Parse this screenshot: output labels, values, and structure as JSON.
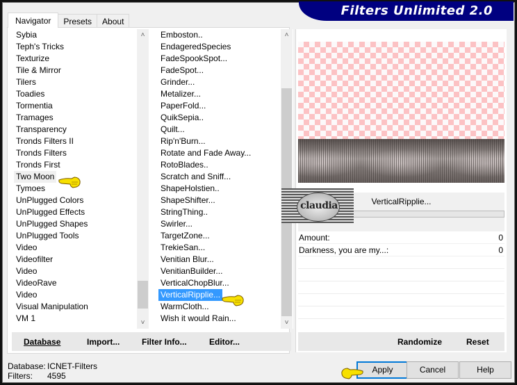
{
  "window": {
    "banner_title": "Filters Unlimited 2.0"
  },
  "tabs": [
    {
      "label": "Navigator",
      "active": true
    },
    {
      "label": "Presets",
      "active": false
    },
    {
      "label": "About",
      "active": false
    }
  ],
  "category_list": {
    "items": [
      "Sybia",
      "Teph's Tricks",
      "Texturize",
      "Tile & Mirror",
      "Tilers",
      "Toadies",
      "Tormentia",
      "Tramages",
      "Transparency",
      "Tronds Filters II",
      "Tronds Filters",
      "Tronds First",
      "Two Moon",
      "Tymoes",
      "UnPlugged Colors",
      "UnPlugged Effects",
      "UnPlugged Shapes",
      "UnPlugged Tools",
      "Video",
      "Videofilter",
      "Video",
      "VideoRave",
      "Video",
      "Visual Manipulation",
      "VM 1"
    ],
    "highlighted": "Two Moon"
  },
  "filter_list": {
    "items": [
      "Emboston..",
      "EndageredSpecies",
      "FadeSpookSpot...",
      "FadeSpot...",
      "Grinder...",
      "Metalizer...",
      "PaperFold...",
      "QuikSepia..",
      "Quilt...",
      "Rip'n'Burn...",
      "Rotate and Fade Away...",
      "RotoBlades..",
      "Scratch and Sniff...",
      "ShapeHolstien..",
      "ShapeShifter...",
      "StringThing..",
      "Swirler...",
      "TargetZone...",
      "TrekieSan...",
      "Venitian Blur...",
      "VenitianBuilder...",
      "VerticalChopBlur...",
      "VerticalRipplie...",
      "WarmCloth...",
      "Wish it would Rain..."
    ],
    "selected": "VerticalRipplie..."
  },
  "left_buttons": {
    "database": "Database",
    "import": "Import...",
    "filter_info": "Filter Info...",
    "editor": "Editor..."
  },
  "preview": {
    "filter_name": "VerticalRipplie...",
    "progress": 0
  },
  "parameters": [
    {
      "label": "Amount:",
      "value": "0"
    },
    {
      "label": "Darkness, you are my...:",
      "value": "0"
    }
  ],
  "right_buttons": {
    "randomize": "Randomize",
    "reset": "Reset"
  },
  "status": {
    "database_label": "Database:",
    "database_value": "ICNET-Filters",
    "filters_label": "Filters:",
    "filters_value": "4595"
  },
  "dialog_buttons": {
    "apply": "Apply",
    "cancel": "Cancel",
    "help": "Help"
  },
  "watermark": {
    "text": "claudia"
  },
  "colors": {
    "banner": "#000080",
    "selection": "#3399ff",
    "checker_pink": "#fcc2c4",
    "default_button_border": "#0078d7"
  }
}
